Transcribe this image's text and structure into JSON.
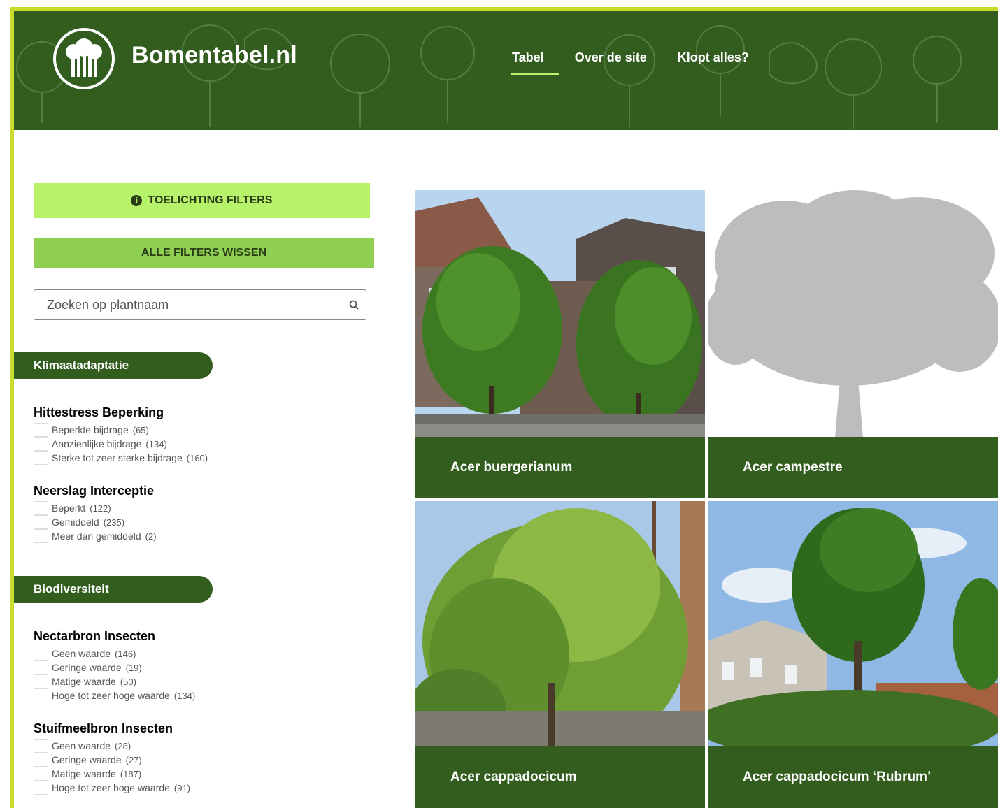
{
  "header": {
    "brand": "Bomentabel.nl",
    "logo_icon": "tree-logo-icon",
    "nav": [
      {
        "label": "Tabel",
        "active": true
      },
      {
        "label": "Over de site",
        "active": false
      },
      {
        "label": "Klopt alles?",
        "active": false
      }
    ]
  },
  "sidebar": {
    "info_button": "TOELICHTING FILTERS",
    "info_icon": "info-icon",
    "clear_button": "ALLE FILTERS WISSEN",
    "search_placeholder": "Zoeken op plantnaam",
    "search_icon": "search-icon",
    "sections": [
      {
        "title": "Klimaatadaptatie",
        "groups": [
          {
            "title": "Hittestress Beperking",
            "options": [
              {
                "label": "Beperkte bijdrage",
                "count": "(65)"
              },
              {
                "label": "Aanzienlijke bijdrage",
                "count": "(134)"
              },
              {
                "label": "Sterke tot zeer sterke bijdrage",
                "count": "(160)"
              }
            ]
          },
          {
            "title": "Neerslag Interceptie",
            "options": [
              {
                "label": "Beperkt",
                "count": "(122)"
              },
              {
                "label": "Gemiddeld",
                "count": "(235)"
              },
              {
                "label": "Meer dan gemiddeld",
                "count": "(2)"
              }
            ]
          }
        ]
      },
      {
        "title": "Biodiversiteit",
        "groups": [
          {
            "title": "Nectarbron Insecten",
            "options": [
              {
                "label": "Geen waarde",
                "count": "(146)"
              },
              {
                "label": "Geringe waarde",
                "count": "(19)"
              },
              {
                "label": "Matige waarde",
                "count": "(50)"
              },
              {
                "label": "Hoge tot zeer hoge waarde",
                "count": "(134)"
              }
            ]
          },
          {
            "title": "Stuifmeelbron Insecten",
            "options": [
              {
                "label": "Geen waarde",
                "count": "(28)"
              },
              {
                "label": "Geringe waarde",
                "count": "(27)"
              },
              {
                "label": "Matige waarde",
                "count": "(187)"
              },
              {
                "label": "Hoge tot zeer hoge waarde",
                "count": "(91)"
              }
            ]
          }
        ]
      }
    ]
  },
  "cards": [
    {
      "name": "Acer buergerianum",
      "image": "street-photo"
    },
    {
      "name": "Acer campestre",
      "image": "silhouette"
    },
    {
      "name": "Acer cappadocicum",
      "image": "street-photo"
    },
    {
      "name": "Acer cappadocicum ‘Rubrum’",
      "image": "street-photo"
    }
  ],
  "colors": {
    "header_green": "#335d1e",
    "accent_lime": "#b7f36a",
    "button_green": "#8fd052",
    "frame_yellow": "#c9dc2b"
  }
}
